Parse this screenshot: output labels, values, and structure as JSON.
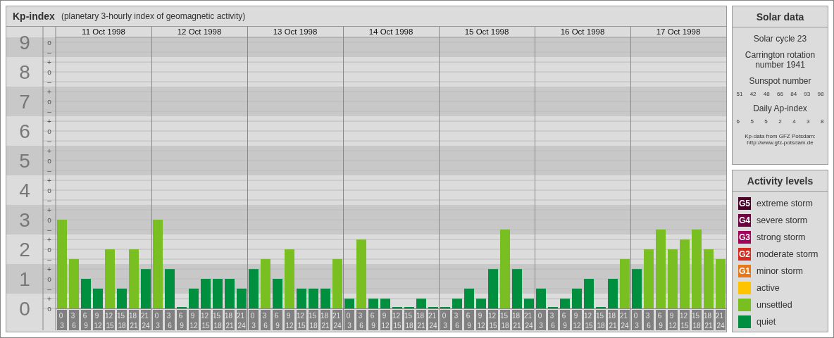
{
  "kp_panel": {
    "title": "Kp-index",
    "subtitle": "(planetary 3-hourly index of geomagnetic activity)",
    "days": [
      "11 Oct 1998",
      "12 Oct 1998",
      "13 Oct 1998",
      "14 Oct 1998",
      "15 Oct 1998",
      "16 Oct 1998",
      "17 Oct 1998"
    ],
    "subdivision_marks": [
      "o",
      "–",
      "+",
      "o",
      "–",
      "+",
      "o",
      "–",
      "+",
      "o",
      "–",
      "+",
      "o",
      "–",
      "+",
      "o",
      "–",
      "+",
      "o",
      "–",
      "+",
      "o",
      "–",
      "+",
      "o",
      "–",
      "+",
      "o"
    ],
    "chart_data": {
      "type": "bar",
      "ylim": [
        0,
        9.17
      ],
      "yticks": [
        0,
        1,
        2,
        3,
        4,
        5,
        6,
        7,
        8,
        9
      ],
      "grid": true,
      "categories": [
        "0 3",
        "3 6",
        "6 9",
        "9 12",
        "12 15",
        "15 18",
        "18 21",
        "21 24",
        "0 3",
        "3 6",
        "6 9",
        "9 12",
        "12 15",
        "15 18",
        "18 21",
        "21 24",
        "0 3",
        "3 6",
        "6 9",
        "9 12",
        "12 15",
        "15 18",
        "18 21",
        "21 24",
        "0 3",
        "3 6",
        "6 9",
        "9 12",
        "12 15",
        "15 18",
        "18 21",
        "21 24",
        "0 3",
        "3 6",
        "6 9",
        "9 12",
        "12 15",
        "15 18",
        "18 21",
        "21 24",
        "0 3",
        "3 6",
        "6 9",
        "9 12",
        "12 15",
        "15 18",
        "18 21",
        "21 24",
        "0 3",
        "3 6",
        "6 9",
        "9 12",
        "12 15",
        "15 18",
        "18 21",
        "21 24"
      ],
      "series": [
        {
          "values": [
            3,
            1.67,
            1,
            0.67,
            2,
            0.67,
            2,
            1.33,
            3,
            1.33,
            0,
            0.67,
            1,
            1,
            1,
            0.67,
            1.33,
            1.67,
            1,
            2,
            0.67,
            0.67,
            0.67,
            1.67,
            0.33,
            2.33,
            0.33,
            0.33,
            0,
            0,
            0.33,
            0,
            0,
            0.33,
            0.67,
            0.33,
            1.33,
            2.67,
            1.33,
            0.33,
            0.67,
            0,
            0.33,
            0.67,
            1,
            0,
            1,
            1.67,
            1.33,
            2,
            2.67,
            2,
            2.33,
            2.67,
            2,
            1.67
          ]
        }
      ]
    }
  },
  "solar_data": {
    "title": "Solar data",
    "cycle": "Solar cycle 23",
    "rotation": "Carrington rotation number 1941",
    "sunspot_title": "Sunspot number",
    "sunspot_numbers": [
      "51",
      "42",
      "48",
      "66",
      "84",
      "93",
      "98"
    ],
    "ap_title": "Daily Ap-index",
    "ap_values": [
      "6",
      "5",
      "5",
      "2",
      "4",
      "3",
      "8"
    ],
    "source": "Kp-data from GFZ Potsdam:",
    "source_url": "http://www.gfz-potsdam.de"
  },
  "activity_levels": {
    "title": "Activity levels",
    "items": [
      {
        "badge": "G5",
        "label": "extreme storm",
        "color": "#4a0028"
      },
      {
        "badge": "G4",
        "label": "severe storm",
        "color": "#6e0042"
      },
      {
        "badge": "G3",
        "label": "strong storm",
        "color": "#a3005c"
      },
      {
        "badge": "G2",
        "label": "moderate storm",
        "color": "#d42b1e"
      },
      {
        "badge": "G1",
        "label": "minor storm",
        "color": "#e8771a"
      },
      {
        "label": "active",
        "color": "#ffc400"
      },
      {
        "label": "unsettled",
        "color": "#7abf21"
      },
      {
        "label": "quiet",
        "color": "#008f3f"
      }
    ]
  }
}
